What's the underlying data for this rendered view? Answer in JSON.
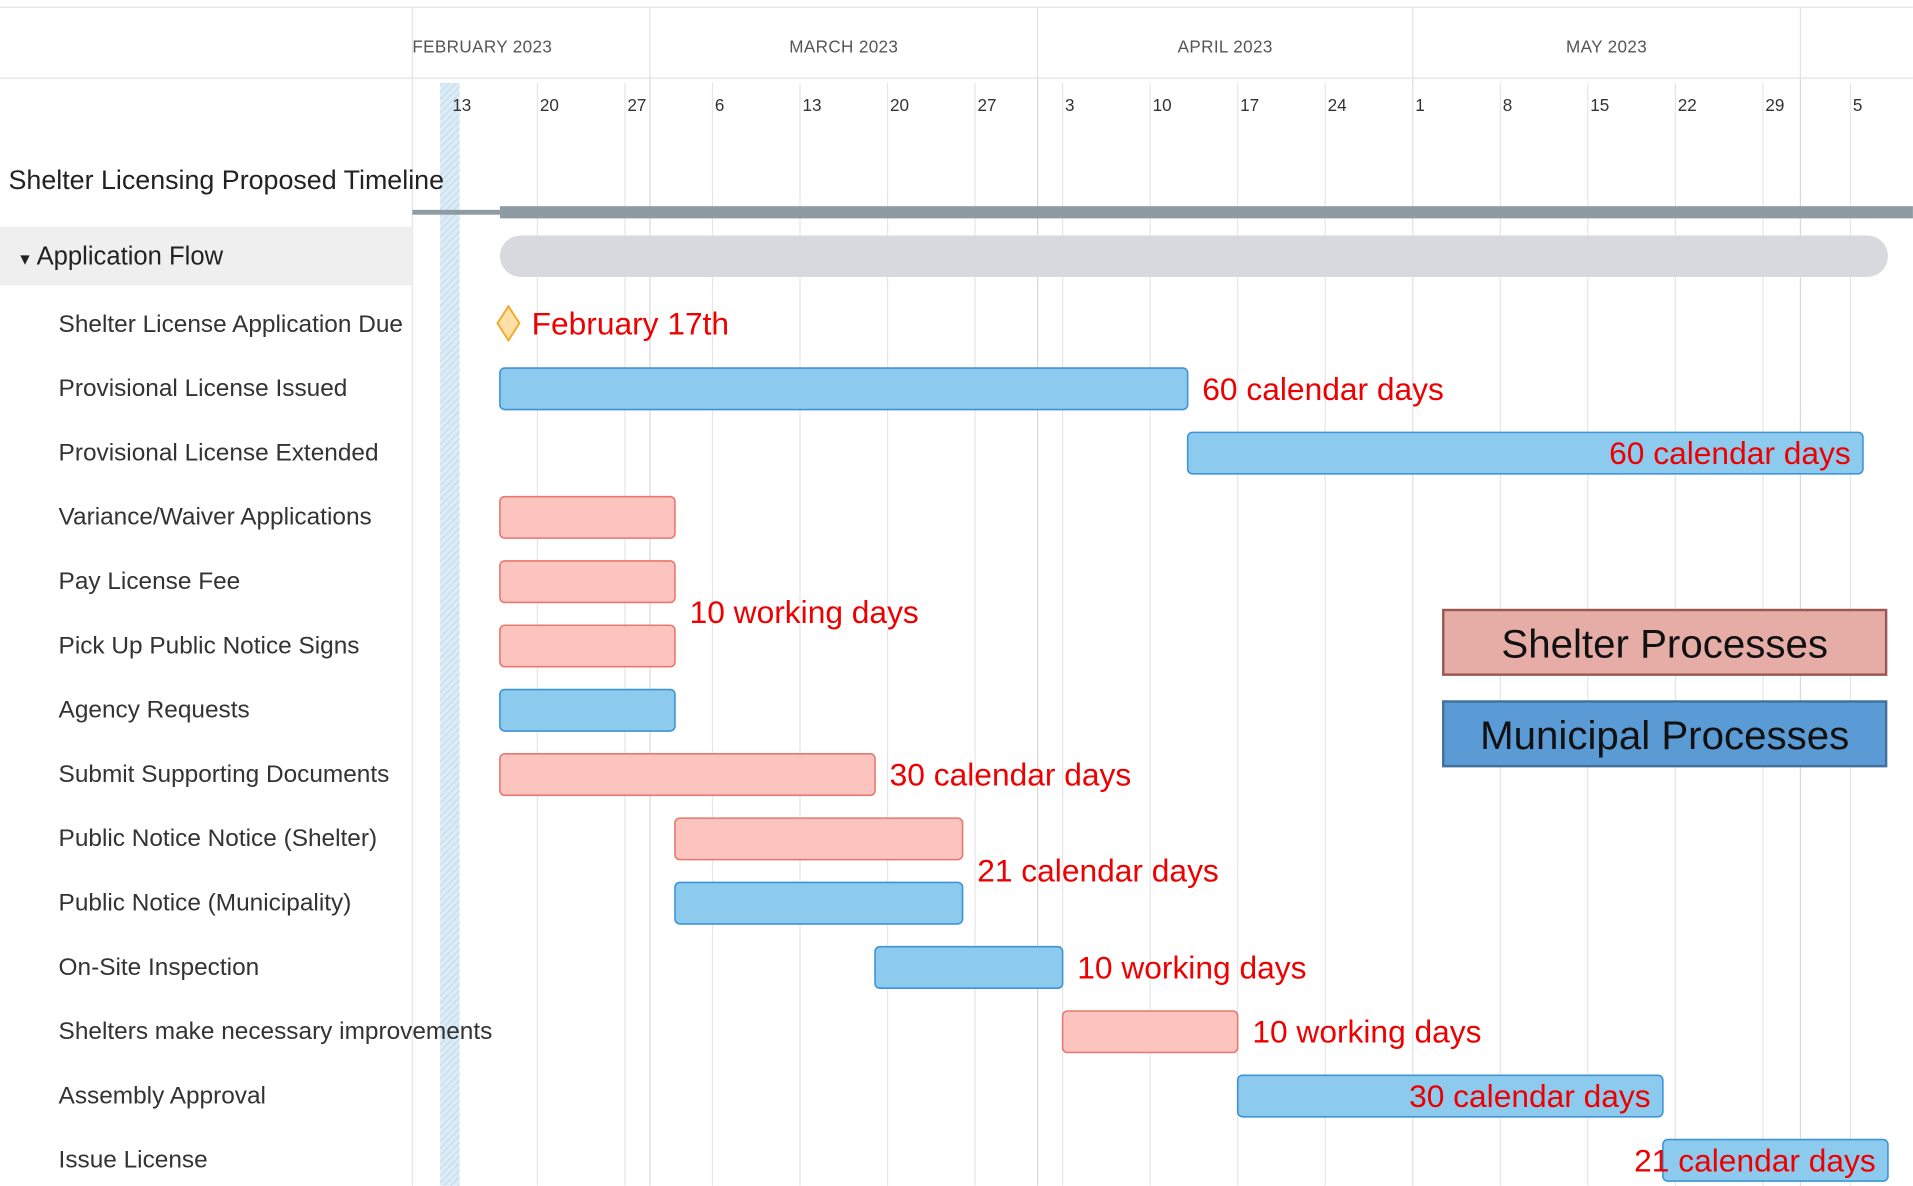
{
  "chart_data": {
    "type": "gantt",
    "title": "Shelter Licensing Proposed Timeline",
    "group": "Application Flow",
    "months": [
      "FEBRUARY 2023",
      "MARCH 2023",
      "APRIL 2023",
      "MAY 2023"
    ],
    "week_ticks": [
      "13",
      "20",
      "27",
      "6",
      "13",
      "20",
      "27",
      "3",
      "10",
      "17",
      "24",
      "1",
      "8",
      "15",
      "22",
      "29",
      "5"
    ],
    "x_range": [
      "2023-02-10",
      "2023-06-10"
    ],
    "today": "2023-02-13",
    "summary_bar": {
      "start": "2023-02-17",
      "end": "2023-06-08"
    },
    "legend": [
      {
        "label": "Shelter Processes",
        "type": "shelter"
      },
      {
        "label": "Municipal Processes",
        "type": "municipal"
      }
    ],
    "tasks": [
      {
        "name": "Shelter License Application Due",
        "type": "milestone",
        "start": "2023-02-17",
        "end": "2023-02-17",
        "note": "February 17th"
      },
      {
        "name": "Provisional License Issued",
        "type": "municipal",
        "start": "2023-02-17",
        "end": "2023-04-13",
        "note": "60 calendar days"
      },
      {
        "name": "Provisional License Extended",
        "type": "municipal",
        "start": "2023-04-13",
        "end": "2023-06-06",
        "note": "60 calendar days"
      },
      {
        "name": "Variance/Waiver Applications",
        "type": "shelter",
        "start": "2023-02-17",
        "end": "2023-03-03",
        "note": ""
      },
      {
        "name": "Pay License Fee",
        "type": "shelter",
        "start": "2023-02-17",
        "end": "2023-03-03",
        "note": "10 working days"
      },
      {
        "name": "Pick Up Public Notice Signs",
        "type": "shelter",
        "start": "2023-02-17",
        "end": "2023-03-03",
        "note": ""
      },
      {
        "name": "Agency Requests",
        "type": "municipal",
        "start": "2023-02-17",
        "end": "2023-03-03",
        "note": ""
      },
      {
        "name": "Submit Supporting Documents",
        "type": "shelter",
        "start": "2023-02-17",
        "end": "2023-03-19",
        "note": "30 calendar days"
      },
      {
        "name": "Public Notice Notice (Shelter)",
        "type": "shelter",
        "start": "2023-03-03",
        "end": "2023-03-26",
        "note": "21 calendar days"
      },
      {
        "name": "Public Notice (Municipality)",
        "type": "municipal",
        "start": "2023-03-03",
        "end": "2023-03-26",
        "note": ""
      },
      {
        "name": "On-Site Inspection",
        "type": "municipal",
        "start": "2023-03-19",
        "end": "2023-04-03",
        "note": "10 working days"
      },
      {
        "name": "Shelters make necessary improvements",
        "type": "shelter",
        "start": "2023-04-03",
        "end": "2023-04-17",
        "note": "10 working days"
      },
      {
        "name": "Assembly Approval",
        "type": "municipal",
        "start": "2023-04-17",
        "end": "2023-05-21",
        "note": "30 calendar days"
      },
      {
        "name": "Issue License",
        "type": "municipal",
        "start": "2023-05-21",
        "end": "2023-06-08",
        "note": "21 calendar days"
      }
    ]
  },
  "colors": {
    "shelter_fill": "#fcc4bf",
    "shelter_stroke": "#e8786d",
    "municipal_fill": "#8ccbee",
    "municipal_stroke": "#3e94d6",
    "milestone_fill": "#ffe0a6",
    "milestone_stroke": "#f5a623",
    "summary_fill": "#d7d9df",
    "project_line": "#8e9ba3",
    "annotation_text": "#ee0000",
    "legend_shelter_fill": "#e6ada6",
    "legend_shelter_stroke": "#9c5852",
    "legend_municipal_fill": "#5b9bd5",
    "legend_municipal_stroke": "#41719c",
    "grid": "#e6e6e6",
    "group_row_bg": "#efefef"
  }
}
